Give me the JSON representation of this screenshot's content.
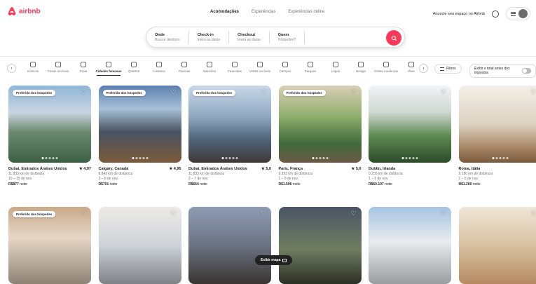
{
  "header": {
    "logo_text": "airbnb",
    "tabs": [
      "Acomodações",
      "Experiências",
      "Experiências online"
    ],
    "host_link": "Anuncie seu espaço no Airbnb"
  },
  "search": {
    "fields": [
      {
        "label": "Onde",
        "value": "Buscar destinos"
      },
      {
        "label": "Check-in",
        "value": "Insira as datas"
      },
      {
        "label": "Checkout",
        "value": "Insira as datas"
      },
      {
        "label": "Quem",
        "value": "Hóspedes?"
      }
    ]
  },
  "categories": {
    "items": [
      "Icônicos",
      "Casas incríveis",
      "Praia",
      "Cidades famosas",
      "Quartos",
      "Castelos",
      "Piscinas",
      "Mansões",
      "Fazendas",
      "Vistas incríveis",
      "Campos",
      "Parques",
      "Lagos",
      "Design",
      "Casas modernas",
      "Ilhas"
    ],
    "active_index": 3,
    "filters_label": "Filtros",
    "taxes_label": "Exibir o total antes dos impostos"
  },
  "listings": [
    {
      "badge": "Preferido dos hóspedes",
      "title": "Dubai, Emirados Árabes Unidos",
      "rating": "4,97",
      "sub1": "11.833 km de distância",
      "sub2": "10 – 15 de nov.",
      "price": "R$877",
      "price_unit": "noite",
      "color": "#8fb7d9"
    },
    {
      "badge": "Preferido dos hóspedes",
      "title": "Calgary, Canadá",
      "rating": "4,95",
      "sub1": "8.843 km de distância",
      "sub2": "3 – 8 de nov.",
      "price": "R$701",
      "price_unit": "noite",
      "color": "#5c7fb0"
    },
    {
      "badge": "Preferido dos hóspedes",
      "title": "Dubai, Emirados Árabes Unidos",
      "rating": "5,0",
      "sub1": "11.833 km de distância",
      "sub2": "2 – 7 de nov.",
      "price": "R$664",
      "price_unit": "noite",
      "color": "#c9d8e8"
    },
    {
      "badge": "Preferido dos hóspedes",
      "title": "Paris, França",
      "rating": "5,0",
      "sub1": "9.393 km de distância",
      "sub2": "1 – 6 de nov.",
      "price": "R$1.506",
      "price_unit": "noite",
      "color": "#d9cfb8"
    },
    {
      "badge": "",
      "title": "Dublin, Irlanda",
      "rating": "",
      "sub1": "9.255 km de distância",
      "sub2": "1 – 6 de nov.",
      "price": "R$60.107",
      "price_unit": "noite",
      "color": "#f1f4f8"
    },
    {
      "badge": "",
      "title": "Roma, Itália",
      "rating": "",
      "sub1": "9.180 km de distância",
      "sub2": "1 – 6 de nov.",
      "price": "R$1.260",
      "price_unit": "noite",
      "color": "#f3efe7"
    },
    {
      "badge": "Preferido dos hóspedes",
      "title": "",
      "rating": "",
      "sub1": "",
      "sub2": "",
      "price": "",
      "price_unit": "",
      "color": "#c9a98a"
    },
    {
      "badge": "",
      "title": "",
      "rating": "",
      "sub1": "",
      "sub2": "",
      "price": "",
      "price_unit": "",
      "color": "#eceae6"
    },
    {
      "badge": "",
      "title": "",
      "rating": "",
      "sub1": "",
      "sub2": "",
      "price": "",
      "price_unit": "",
      "color": "#8e9cb2"
    },
    {
      "badge": "",
      "title": "",
      "rating": "",
      "sub1": "",
      "sub2": "",
      "price": "",
      "price_unit": "",
      "color": "#4a5566"
    },
    {
      "badge": "",
      "title": "",
      "rating": "",
      "sub1": "",
      "sub2": "",
      "price": "",
      "price_unit": "",
      "color": "#a6c4e2"
    },
    {
      "badge": "",
      "title": "",
      "rating": "",
      "sub1": "",
      "sub2": "",
      "price": "",
      "price_unit": "",
      "color": "#efe6d8"
    }
  ],
  "map_button": {
    "label": "Exibir mapa"
  },
  "colors": {
    "brand": "#ff385c"
  }
}
